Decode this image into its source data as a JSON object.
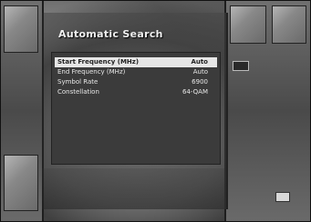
{
  "screen": {
    "title": "Automatic Search",
    "menu": [
      {
        "label": "Start Frequency (MHz)",
        "value": "Auto",
        "selected": true
      },
      {
        "label": "End Frequency (MHz)",
        "value": "Auto",
        "selected": false
      },
      {
        "label": "Symbol Rate",
        "value": "6900",
        "selected": false
      },
      {
        "label": "Constellation",
        "value": "64-QAM",
        "selected": false
      }
    ],
    "side_tag": "",
    "colors": {
      "highlight": "#e6e6e6",
      "menu_bg": "#3b3b3b",
      "text": "#e8e8e8"
    },
    "icons": [
      "remote-key-icon"
    ]
  }
}
